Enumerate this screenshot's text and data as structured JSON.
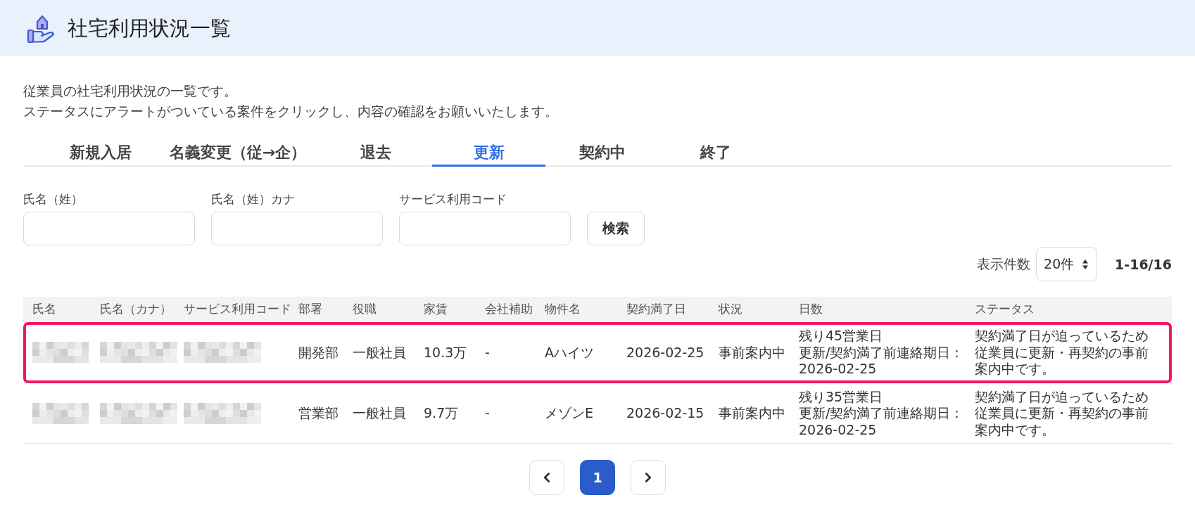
{
  "header": {
    "title": "社宅利用状況一覧"
  },
  "description": [
    "従業員の社宅利用状況の一覧です。",
    "ステータスにアラートがついている案件をクリックし、内容の確認をお願いいたします。"
  ],
  "tabs": [
    {
      "label": "新規入居",
      "selected": false
    },
    {
      "label": "名義変更（従→企）",
      "selected": false
    },
    {
      "label": "退去",
      "selected": false
    },
    {
      "label": "更新",
      "selected": true
    },
    {
      "label": "契約中",
      "selected": false
    },
    {
      "label": "終了",
      "selected": false
    }
  ],
  "filters": {
    "fields": [
      {
        "label": "氏名（姓）"
      },
      {
        "label": "氏名（姓）カナ"
      },
      {
        "label": "サービス利用コード"
      }
    ],
    "search_button": "検索"
  },
  "page_size": {
    "label": "表示件数",
    "value": "20件"
  },
  "range": "1-16/16",
  "table": {
    "columns": [
      "氏名",
      "氏名（カナ）",
      "サービス利用コード",
      "部署",
      "役職",
      "家賃",
      "会社補助",
      "物件名",
      "契約満了日",
      "状況",
      "日数",
      "ステータス"
    ],
    "rows": [
      {
        "highlighted": true,
        "name_redacted": true,
        "kana_redacted": true,
        "service_code_redacted": true,
        "department": "開発部",
        "position": "一般社員",
        "rent": "10.3万",
        "company_subsidy": "-",
        "property": "Aハイツ",
        "contract_end": "2026-02-25",
        "situation": "事前案内中",
        "days": [
          "残り45営業日",
          "更新/契約満了前連絡期日：",
          "2026-02-25"
        ],
        "status": "契約満了日が迫っているため従業員に更新・再契約の事前案内中です。"
      },
      {
        "highlighted": false,
        "name_redacted": true,
        "kana_redacted": true,
        "service_code_redacted": true,
        "department": "営業部",
        "position": "一般社員",
        "rent": "9.7万",
        "company_subsidy": "-",
        "property": "メゾンE",
        "contract_end": "2026-02-15",
        "situation": "事前案内中",
        "days": [
          "残り35営業日",
          "更新/契約満了前連絡期日：",
          "2026-02-25"
        ],
        "status": "契約満了日が迫っているため従業員に更新・再契約の事前案内中です。"
      }
    ]
  },
  "pagination": {
    "pages": [
      {
        "label": "1",
        "selected": true
      }
    ]
  }
}
